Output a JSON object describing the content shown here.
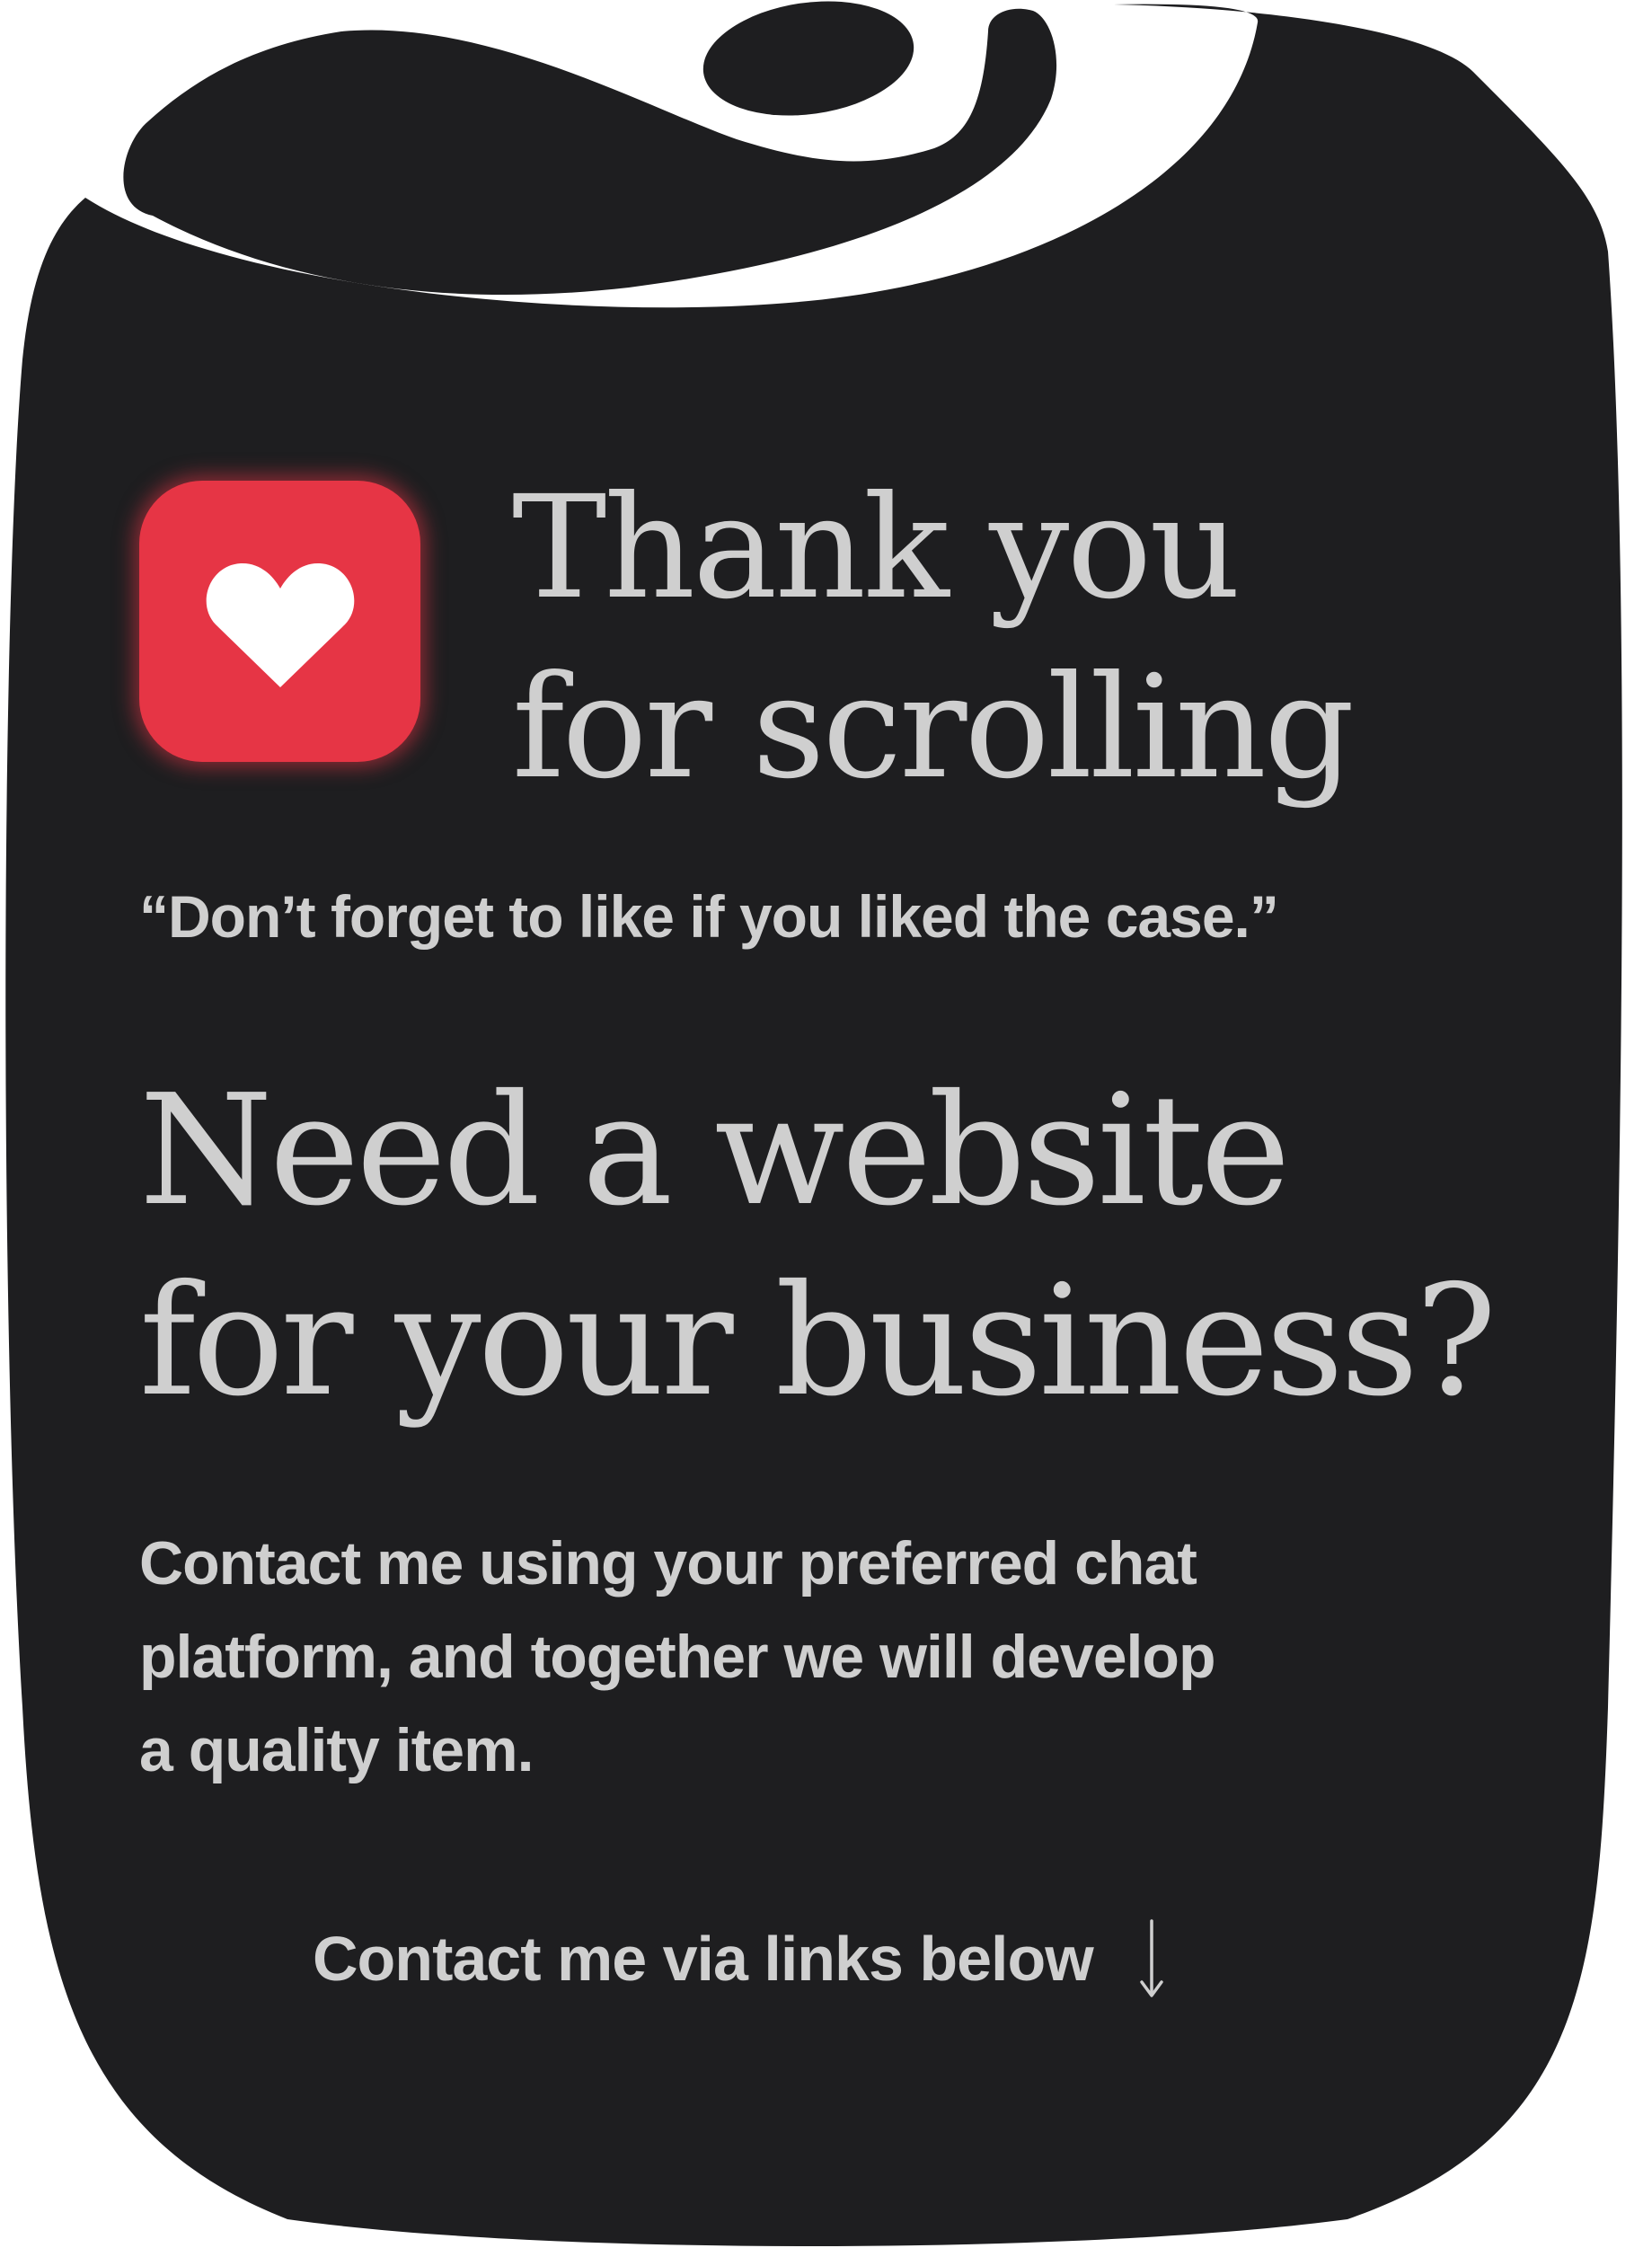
{
  "colors": {
    "card_background": "#1e1e20",
    "page_background": "#ffffff",
    "text": "#cfcfcf",
    "like_accent": "#e63545",
    "heart": "#ffffff"
  },
  "like": {
    "icon": "heart-icon"
  },
  "thanks": {
    "line1": "Thank you",
    "line2": "for scrolling"
  },
  "quote": "“Don’t forget to like if you liked the case.”",
  "headline": {
    "line1": "Need a website",
    "line2": "for your business?"
  },
  "body": {
    "line1": "Contact me using your preferred chat",
    "line2": "platform, and together we will develop",
    "line3": "a quality item."
  },
  "cta": {
    "label": "Contact me via links below",
    "icon": "arrow-down-icon"
  }
}
